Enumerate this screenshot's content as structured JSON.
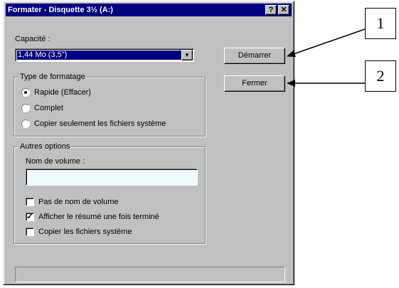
{
  "window": {
    "title": "Formater - Disquette 3½ (A:)"
  },
  "titlebar": {
    "help": "?",
    "close": "✕"
  },
  "capacity": {
    "label": "Capacité :",
    "value": "1,44 Mo (3,5\")"
  },
  "format_type": {
    "title": "Type de formatage",
    "options": [
      {
        "label": "Rapide (Effacer)",
        "selected": true
      },
      {
        "label": "Complet",
        "selected": false
      },
      {
        "label": "Copier seulement les fichiers système",
        "selected": false
      }
    ]
  },
  "other_options": {
    "title": "Autres options",
    "volume_label": "Nom de volume :",
    "volume_value": "",
    "checkboxes": [
      {
        "label": "Pas de nom de volume",
        "checked": false
      },
      {
        "label": "Afficher le résumé une fois terminé",
        "checked": true
      },
      {
        "label": "Copier les fichiers système",
        "checked": false
      }
    ]
  },
  "buttons": {
    "start": "Démarrer",
    "close": "Fermer"
  },
  "callouts": [
    "1",
    "2"
  ],
  "check_mark": "✓"
}
